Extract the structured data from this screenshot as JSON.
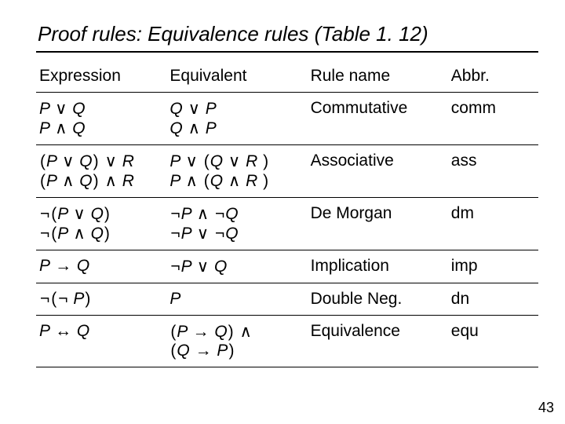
{
  "title": "Proof rules: Equivalence rules (Table 1. 12)",
  "page_number": "43",
  "headers": {
    "expression": "Expression",
    "equivalent": "Equivalent",
    "rule_name": "Rule name",
    "abbr": "Abbr."
  },
  "rows": [
    {
      "expression": "P ∨ Q\nP ∧ Q",
      "equivalent": "Q ∨ P\nQ ∧ P",
      "rule_name": "Commutative",
      "abbr": "comm"
    },
    {
      "expression": "(P ∨ Q) ∨ R\n(P ∧ Q) ∧ R",
      "equivalent": "P ∨ (Q ∨ R )\nP ∧ (Q ∧ R )",
      "rule_name": "Associative",
      "abbr": "ass"
    },
    {
      "expression": "¬(P ∨ Q)\n¬(P ∧ Q)",
      "equivalent": "¬P ∧ ¬Q\n¬P ∨ ¬Q",
      "rule_name": "De Morgan",
      "abbr": "dm"
    },
    {
      "expression": "P → Q",
      "equivalent": "¬P ∨ Q",
      "rule_name": "Implication",
      "abbr": "imp"
    },
    {
      "expression": "¬(¬ P)",
      "equivalent": "P",
      "rule_name": "Double Neg.",
      "abbr": "dn"
    },
    {
      "expression": "P ↔ Q",
      "equivalent": "(P → Q) ∧\n(Q → P)",
      "rule_name": "Equivalence",
      "abbr": "equ"
    }
  ],
  "chart_data": {
    "type": "table",
    "title": "Proof rules: Equivalence rules (Table 1.12)",
    "columns": [
      "Expression",
      "Equivalent",
      "Rule name",
      "Abbr."
    ],
    "rows": [
      [
        "P ∨ Q ; P ∧ Q",
        "Q ∨ P ; Q ∧ P",
        "Commutative",
        "comm"
      ],
      [
        "(P ∨ Q) ∨ R ; (P ∧ Q) ∧ R",
        "P ∨ (Q ∨ R) ; P ∧ (Q ∧ R)",
        "Associative",
        "ass"
      ],
      [
        "¬(P ∨ Q) ; ¬(P ∧ Q)",
        "¬P ∧ ¬Q ; ¬P ∨ ¬Q",
        "De Morgan",
        "dm"
      ],
      [
        "P → Q",
        "¬P ∨ Q",
        "Implication",
        "imp"
      ],
      [
        "¬(¬P)",
        "P",
        "Double Neg.",
        "dn"
      ],
      [
        "P ↔ Q",
        "(P → Q) ∧ (Q → P)",
        "Equivalence",
        "equ"
      ]
    ]
  }
}
